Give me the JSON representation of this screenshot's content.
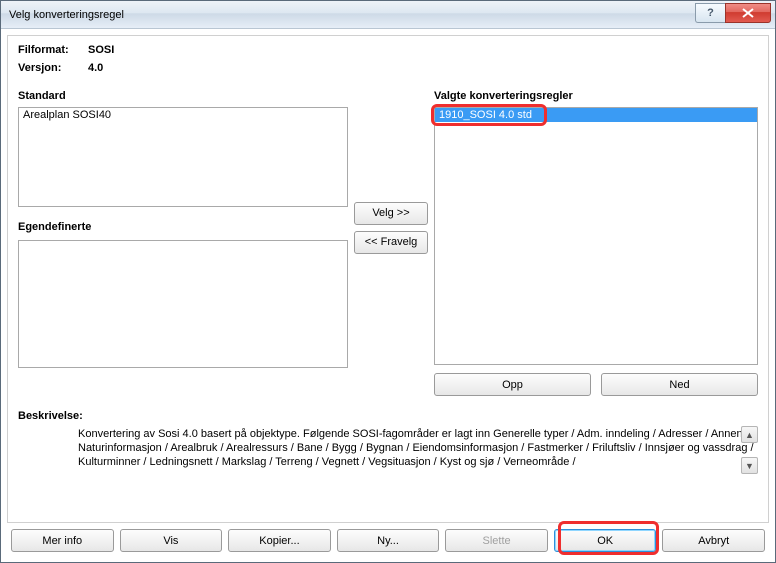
{
  "window": {
    "title": "Velg konverteringsregel"
  },
  "info": {
    "filformat_label": "Filformat:",
    "filformat_value": "SOSI",
    "versjon_label": "Versjon:",
    "versjon_value": "4.0"
  },
  "left": {
    "standard_label": "Standard",
    "standard_items": [
      "Arealplan SOSI40"
    ],
    "userdef_label": "Egendefinerte"
  },
  "mid": {
    "velg_label": "Velg >>",
    "fravelg_label": "<< Fravelg"
  },
  "right": {
    "heading": "Valgte konverteringsregler",
    "items": [
      "1910_SOSI 4.0 std"
    ],
    "opp_label": "Opp",
    "ned_label": "Ned"
  },
  "beskrivelse": {
    "label": "Beskrivelse:",
    "text": "Konvertering av Sosi 4.0 basert på objektype. Følgende SOSI-fagområder er lagt inn Generelle typer / Adm. inndeling / Adresser / Annen Naturinformasjon / Arealbruk / Arealressurs / Bane / Bygg / Bygnan / Eiendomsinformasjon / Fastmerker / Friluftsliv / Innsjøer og vassdrag / Kulturminner / Ledningsnett / Markslag / Terreng / Vegnett / Vegsituasjon / Kyst og sjø / Verneområde /"
  },
  "buttons": {
    "mer_info": "Mer info",
    "vis": "Vis",
    "kopier": "Kopier...",
    "ny": "Ny...",
    "slette": "Slette",
    "ok": "OK",
    "avbryt": "Avbryt"
  }
}
